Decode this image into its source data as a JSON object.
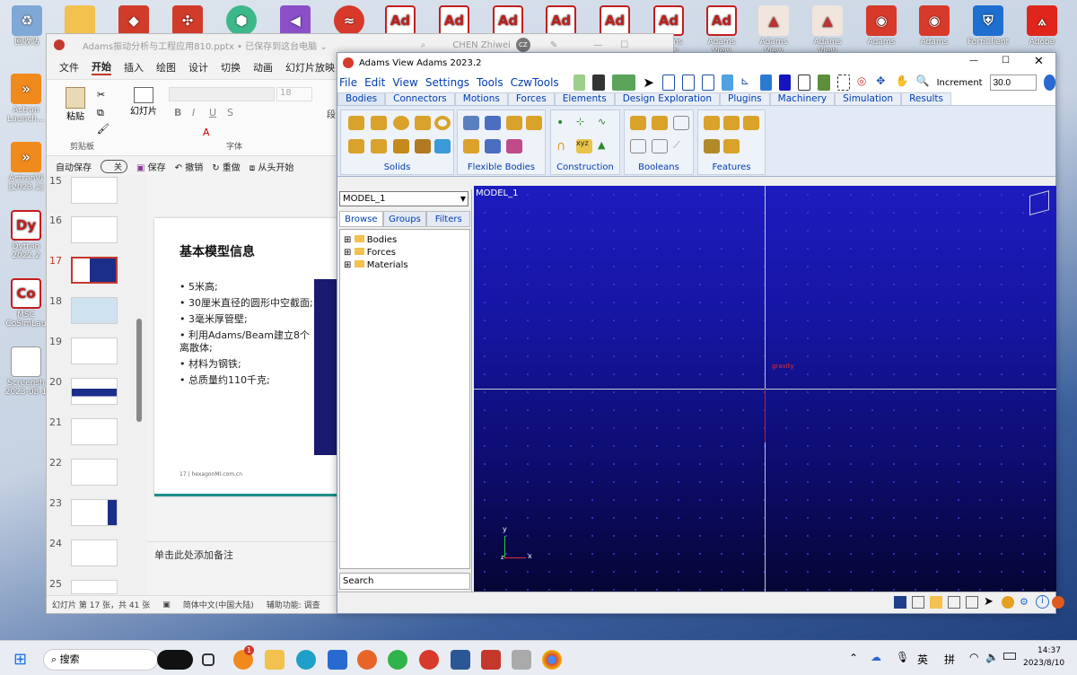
{
  "desktop": {
    "icons_top": [
      "回收站",
      "",
      "",
      "",
      "",
      "",
      "",
      "Ad",
      "Ad",
      "Ad",
      "Ad",
      "Ad",
      "Ad",
      "Ad",
      "",
      "",
      "",
      "",
      "",
      "",
      ""
    ],
    "icons_top_labels": [
      "回收站",
      "Adams View",
      "Adams View",
      "Adams View",
      "Adams View",
      "Adams",
      "Adams",
      "FortiClient",
      "Adobe"
    ],
    "icons_left": [
      {
        "label": "Actran Launch...",
        "text": ""
      },
      {
        "label": "ActranVI [2023.1]",
        "text": ""
      },
      {
        "label": "Dytran 2022.2",
        "text": "Dy"
      },
      {
        "label": "MSC CoSimLau",
        "text": "Co"
      },
      {
        "label": "Screensh 2023-08-1",
        "text": ""
      }
    ]
  },
  "ppt": {
    "title": "Adams振动分析与工程应用810.pptx • 已保存到这台电脑 ⌄",
    "user": "CHEN Zhiwei",
    "user_initials": "CZ",
    "menu": [
      "文件",
      "开始",
      "插入",
      "绘图",
      "设计",
      "切换",
      "动画",
      "幻灯片放映"
    ],
    "ribbon": {
      "paste": "粘贴",
      "clipboard": "剪贴板",
      "slides": "幻灯片",
      "font": "字体",
      "font_size": "18",
      "para": "段",
      "autosave": "自动保存",
      "autosave_state": "关",
      "save": "保存",
      "undo": "撤销",
      "redo": "重做",
      "from_start": "从头开始"
    },
    "slide_numbers": [
      "15",
      "16",
      "17",
      "18",
      "19",
      "20",
      "21",
      "22",
      "23",
      "24",
      "25"
    ],
    "slide": {
      "title": "基本模型信息",
      "bullets": [
        "5米高;",
        "30厘米直径的圆形中空截面;",
        "3毫米厚管壁;",
        "利用Adams/Beam建立8个离散体;",
        "材料为钢铁;",
        "总质量约110千克;"
      ],
      "footer": "17  |  hexagonMI.com.cn"
    },
    "notes": "单击此处添加备注",
    "status": {
      "slide": "幻灯片 第 17 张，共 41 张",
      "lang": "简体中文(中国大陆)",
      "access": "辅助功能: 调查"
    }
  },
  "adams": {
    "title": "Adams View Adams 2023.2",
    "menu": [
      "File",
      "Edit",
      "View",
      "Settings",
      "Tools",
      "CzwTools"
    ],
    "increment_label": "Increment",
    "increment_value": "30.0",
    "tabs": [
      "Bodies",
      "Connectors",
      "Motions",
      "Forces",
      "Elements",
      "Design Exploration",
      "Plugins",
      "Machinery",
      "Simulation",
      "Results"
    ],
    "groups": [
      "Solids",
      "Flexible Bodies",
      "Construction",
      "Booleans",
      "Features"
    ],
    "model": "MODEL_1",
    "browser_tabs": [
      "Browse",
      "Groups",
      "Filters"
    ],
    "tree": [
      "Bodies",
      "Forces",
      "Materials"
    ],
    "search": "Search",
    "canvas_label": "MODEL_1",
    "gravity": "gravity",
    "axis_y": "y",
    "axis_x": "x",
    "axis_z": "z"
  },
  "taskbar": {
    "search": "搜索",
    "lang": "英",
    "ime": "拼",
    "time": "14:37",
    "date": "2023/8/10",
    "badge": "1"
  },
  "colors": {
    "accent_red": "#d73a2a",
    "adams_blue": "#003eb0"
  }
}
